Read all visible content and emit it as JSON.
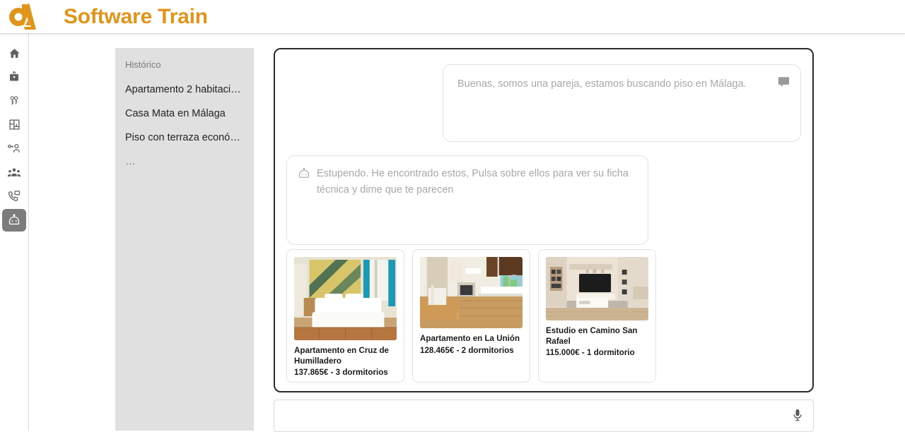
{
  "header": {
    "brand_title": "Software Train",
    "logo_color": "#e09419",
    "logo_icon": "logo-6a-mark"
  },
  "sidebar": {
    "items": [
      {
        "icon": "home-icon",
        "name": "home",
        "selected": false
      },
      {
        "icon": "briefcase-icon",
        "name": "portfolio",
        "selected": false
      },
      {
        "icon": "keys-icon",
        "name": "keys",
        "selected": false
      },
      {
        "icon": "floorplan-icon",
        "name": "floorplan",
        "selected": false
      },
      {
        "icon": "user-key-icon",
        "name": "owner",
        "selected": false
      },
      {
        "icon": "people-group-icon",
        "name": "clients",
        "selected": false
      },
      {
        "icon": "phone-message-icon",
        "name": "calls",
        "selected": false
      },
      {
        "icon": "robot-icon",
        "name": "assistant",
        "selected": true
      }
    ],
    "selected_background": "#7c7c7c"
  },
  "history": {
    "title": "Histórico",
    "items": [
      "Apartamento 2 habitacion…",
      "Casa Mata en Málaga",
      "Piso con terraza económi…",
      "…"
    ]
  },
  "chat": {
    "messages": [
      {
        "role": "user",
        "text": "Buenas, somos una pareja, estamos buscando piso en Málaga.",
        "icon": "chat-bubble-icon"
      },
      {
        "role": "assistant",
        "text": "Estupendo. He encontrado estos, Pulsa sobre ellos para ver su ficha técnica y dime que te parecen",
        "icon": "robot-icon"
      }
    ],
    "cards": [
      {
        "title": "Apartamento en Cruz de Humilladero",
        "price": "137.865€ - 3 dormitorios",
        "image_alt": "bedroom-photo"
      },
      {
        "title": "Apartamento en La Unión",
        "price": "128.465€ - 2 dormitorios",
        "image_alt": "kitchen-photo"
      },
      {
        "title": "Estudio en Camino San Rafael",
        "price": "115.000€ - 1 dormitorio",
        "image_alt": "living-room-photo"
      }
    ]
  },
  "composer": {
    "value": "",
    "placeholder": "",
    "mic_icon": "microphone-icon"
  }
}
